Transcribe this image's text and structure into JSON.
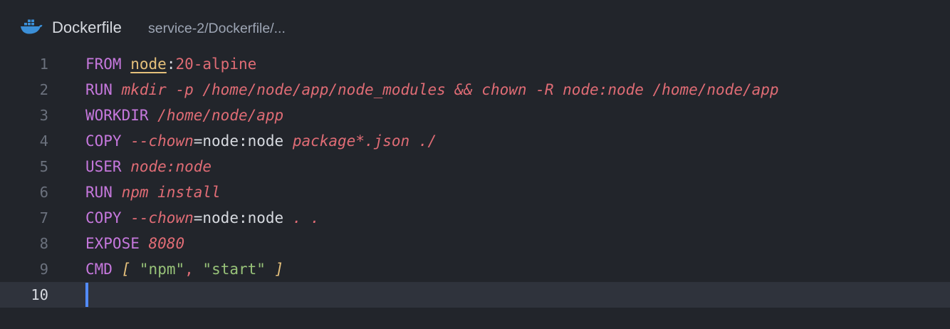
{
  "tab": {
    "icon": "docker-whale-icon",
    "title": "Dockerfile",
    "path": "service-2/Dockerfile/..."
  },
  "colors": {
    "background": "#22252b",
    "keyword": "#c678dd",
    "argument": "#e06c75",
    "string": "#98c379",
    "image": "#e5c07b",
    "cursor": "#528bff",
    "current_line": "#2f333c"
  },
  "lines": [
    {
      "n": "1",
      "tokens": [
        {
          "t": "FROM",
          "c": "kw"
        },
        {
          "t": " ",
          "c": "pn"
        },
        {
          "t": "node",
          "c": "im"
        },
        {
          "t": ":",
          "c": "pn"
        },
        {
          "t": "20-alpine",
          "c": "pl"
        }
      ]
    },
    {
      "n": "2",
      "tokens": [
        {
          "t": "RUN",
          "c": "kw"
        },
        {
          "t": " ",
          "c": "pn"
        },
        {
          "t": "mkdir -p /home/node/app/node_modules && chown -R node:node /home/node/app",
          "c": "it"
        }
      ]
    },
    {
      "n": "3",
      "tokens": [
        {
          "t": "WORKDIR",
          "c": "kw"
        },
        {
          "t": " ",
          "c": "pn"
        },
        {
          "t": "/home/node/app",
          "c": "it"
        }
      ]
    },
    {
      "n": "4",
      "tokens": [
        {
          "t": "COPY",
          "c": "kw"
        },
        {
          "t": " ",
          "c": "pn"
        },
        {
          "t": "--chown",
          "c": "it"
        },
        {
          "t": "=node:node ",
          "c": "pn"
        },
        {
          "t": "package*.json ./",
          "c": "it"
        }
      ]
    },
    {
      "n": "5",
      "tokens": [
        {
          "t": "USER",
          "c": "kw"
        },
        {
          "t": " ",
          "c": "pn"
        },
        {
          "t": "node:node",
          "c": "it"
        }
      ]
    },
    {
      "n": "6",
      "tokens": [
        {
          "t": "RUN",
          "c": "kw"
        },
        {
          "t": " ",
          "c": "pn"
        },
        {
          "t": "npm install",
          "c": "it"
        }
      ]
    },
    {
      "n": "7",
      "tokens": [
        {
          "t": "COPY",
          "c": "kw"
        },
        {
          "t": " ",
          "c": "pn"
        },
        {
          "t": "--chown",
          "c": "it"
        },
        {
          "t": "=node:node ",
          "c": "pn"
        },
        {
          "t": ". .",
          "c": "it"
        }
      ]
    },
    {
      "n": "8",
      "tokens": [
        {
          "t": "EXPOSE",
          "c": "kw"
        },
        {
          "t": " ",
          "c": "pn"
        },
        {
          "t": "8080",
          "c": "it"
        }
      ]
    },
    {
      "n": "9",
      "tokens": [
        {
          "t": "CMD",
          "c": "kw"
        },
        {
          "t": " ",
          "c": "pn"
        },
        {
          "t": "[",
          "c": "br"
        },
        {
          "t": " ",
          "c": "pn"
        },
        {
          "t": "\"npm\"",
          "c": "st"
        },
        {
          "t": ", ",
          "c": "pl"
        },
        {
          "t": "\"start\"",
          "c": "st"
        },
        {
          "t": " ",
          "c": "pn"
        },
        {
          "t": "]",
          "c": "br"
        }
      ]
    },
    {
      "n": "10",
      "current": true,
      "tokens": []
    }
  ]
}
